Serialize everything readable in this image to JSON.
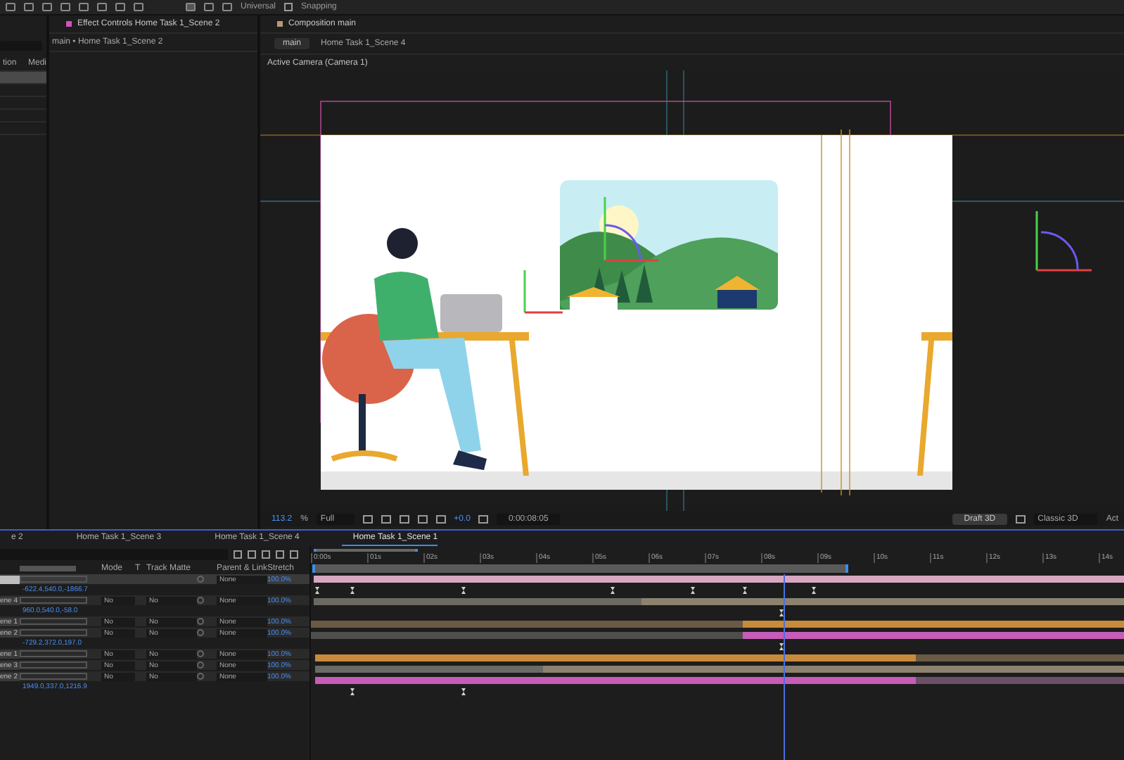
{
  "toolbar": {
    "axis_mode": "Universal",
    "snapping": {
      "label": "Snapping",
      "checked": false
    }
  },
  "project_panel": {
    "columns": [
      "tion",
      "Medi"
    ],
    "rows": [
      {
        "selected": true
      },
      {
        "selected": false
      },
      {
        "selected": false
      },
      {
        "selected": false
      },
      {
        "selected": false
      }
    ]
  },
  "effect_controls": {
    "tab_title": "Effect Controls Home Task 1_Scene 2",
    "subtitle": "main • Home Task 1_Scene 2"
  },
  "composition": {
    "tab_title": "Composition main",
    "breadcrumb": {
      "current": "main",
      "next": "Home Task 1_Scene 4"
    },
    "camera_label": "Active Camera (Camera 1)",
    "viewer_controls": {
      "zoom": "113.2",
      "zoom_unit": "%",
      "resolution": "Full",
      "exposure": "+0.0",
      "timecode": "0:00:08:05",
      "draft_3d": "Draft 3D",
      "renderer": "Classic 3D",
      "cut_label": "Act"
    }
  },
  "timeline": {
    "tabs": [
      {
        "label": "e 2",
        "selected": false
      },
      {
        "label": "Home Task 1_Scene 3",
        "selected": false
      },
      {
        "label": "Home Task 1_Scene 4",
        "selected": false
      },
      {
        "label": "Home Task 1_Scene 1",
        "selected": true
      }
    ],
    "columns": {
      "mode": "Mode",
      "t": "T",
      "track_matte": "Track Matte",
      "parent": "Parent & Link",
      "stretch": "Stretch"
    },
    "ruler": [
      "0:00s",
      "01s",
      "02s",
      "03s",
      "04s",
      "05s",
      "06s",
      "07s",
      "08s",
      "09s",
      "10s",
      "11s",
      "12s",
      "13s",
      "14s"
    ],
    "rows": [
      {
        "kind": "layer",
        "name": "",
        "selected": true,
        "parent": "None",
        "stretch": "100.0%"
      },
      {
        "kind": "value",
        "text": "-622.4,540.0,-1866.7"
      },
      {
        "kind": "layer",
        "name": "ene 4",
        "selected": false,
        "mode": "No",
        "track_matte": "No",
        "parent": "None",
        "stretch": "100.0%"
      },
      {
        "kind": "value",
        "text": "960.0,540.0,-58.0"
      },
      {
        "kind": "layer",
        "name": "ene 1",
        "selected": false,
        "mode": "No",
        "track_matte": "No",
        "parent": "None",
        "stretch": "100.0%"
      },
      {
        "kind": "layer",
        "name": "ene 2",
        "selected": false,
        "mode": "No",
        "track_matte": "No",
        "parent": "None",
        "stretch": "100.0%"
      },
      {
        "kind": "value",
        "text": "-729.2,372.0,197.0"
      },
      {
        "kind": "layer",
        "name": "ene 1",
        "selected": false,
        "mode": "No",
        "track_matte": "No",
        "parent": "None",
        "stretch": "100.0%"
      },
      {
        "kind": "layer",
        "name": "ene 3",
        "selected": false,
        "mode": "No",
        "track_matte": "No",
        "parent": "None",
        "stretch": "100.0%"
      },
      {
        "kind": "layer",
        "name": "ene 2",
        "selected": false,
        "mode": "No",
        "track_matte": "No",
        "parent": "None",
        "stretch": "100.0%"
      },
      {
        "kind": "value",
        "text": "1949.0,337.0,1216.9"
      }
    ]
  }
}
